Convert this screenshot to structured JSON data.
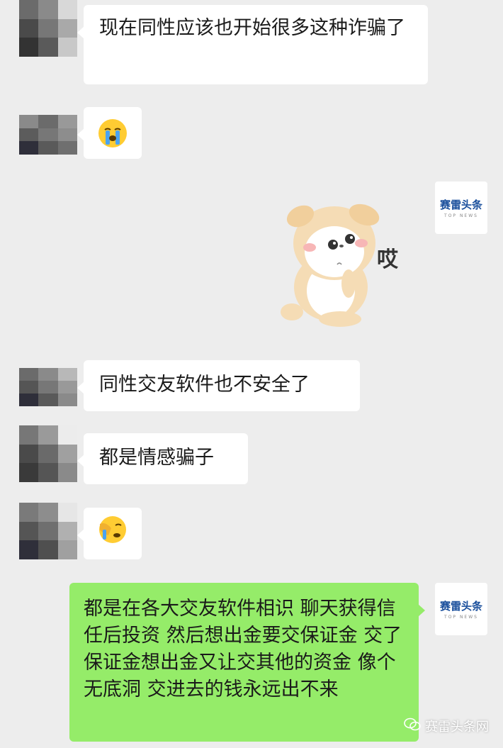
{
  "messages": [
    {
      "text": "现在同性应该也开始很多这种诈骗了"
    },
    {
      "emoji": "crying-face-emoji"
    },
    {
      "sticker_text": "哎"
    },
    {
      "text": "同性交友软件也不安全了"
    },
    {
      "text": "都是情感骗子"
    },
    {
      "emoji": "face-palm-emoji"
    },
    {
      "text": "都是在各大交友软件相识 聊天获得信任后投资 然后想出金要交保证金 交了保证金想出金又让交其他的资金 像个无底洞 交进去的钱永远出不来"
    }
  ],
  "brand": {
    "name": "赛雷头条",
    "sub": "TOP NEWS"
  },
  "watermark": {
    "text": "赛雷头条网"
  },
  "colors": {
    "background": "#ededed",
    "bubble": "#ffffff",
    "self_bubble": "#95ec69",
    "brand": "#1a4f9c"
  }
}
